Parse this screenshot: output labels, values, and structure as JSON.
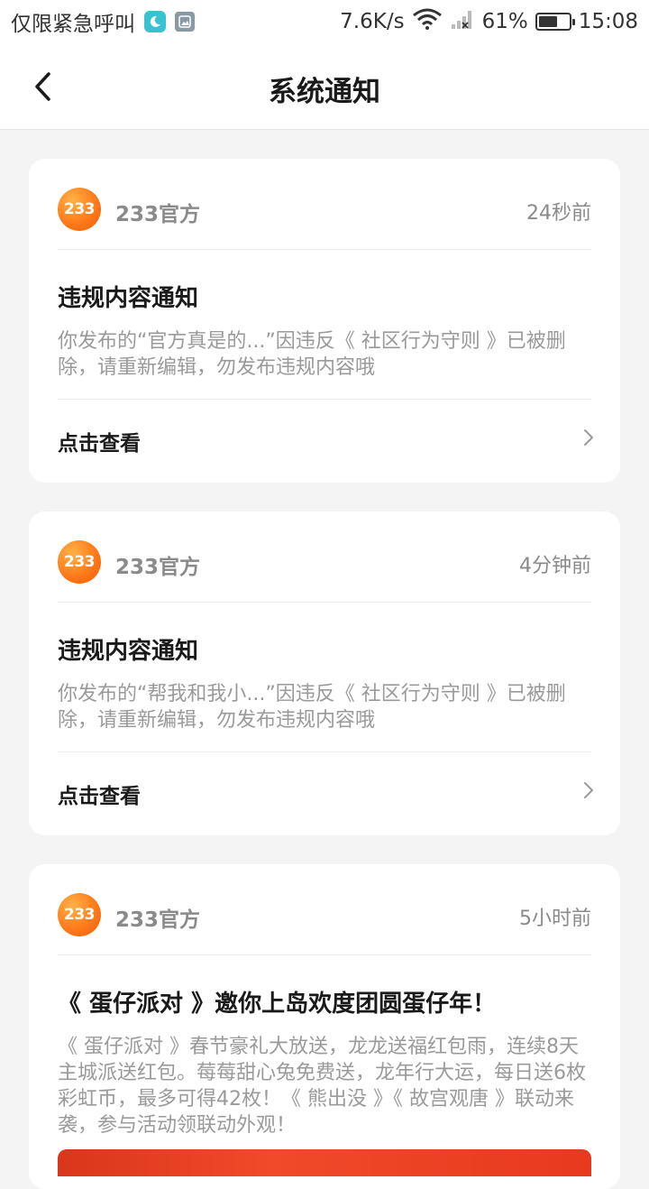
{
  "status_bar": {
    "carrier_text": "仅限紧急呼叫",
    "net_speed": "7.6K/s",
    "battery_percent": "61%",
    "battery_level": 0.61,
    "time": "15:08"
  },
  "nav": {
    "title": "系统通知"
  },
  "notifications": [
    {
      "author": "233官方",
      "avatar_text": "233",
      "time": "24秒前",
      "title": "违规内容通知",
      "body": "你发布的“官方真是的...”因违反《 社区行为守则 》已被删除，请重新编辑，勿发布违规内容哦",
      "link_label": "点击查看"
    },
    {
      "author": "233官方",
      "avatar_text": "233",
      "time": "4分钟前",
      "title": "违规内容通知",
      "body": "你发布的“帮我和我小...”因违反《 社区行为守则 》已被删除，请重新编辑，勿发布违规内容哦",
      "link_label": "点击查看"
    },
    {
      "author": "233官方",
      "avatar_text": "233",
      "time": "5小时前",
      "title": "《 蛋仔派对 》邀你上岛欢度团圆蛋仔年！",
      "body": "《 蛋仔派对 》春节豪礼大放送，龙龙送福红包雨，连续8天主城派送红包。莓莓甜心兔免费送，龙年行大运，每日送6枚彩虹币，最多可得42枚！《 熊出没 》《 故宫观唐 》联动来袭，参与活动领联动外观！"
    }
  ],
  "colors": {
    "accent": "#ff7a1a",
    "page_bg": "#f4f4f4",
    "card_bg": "#ffffff",
    "muted_text": "#8a8a8a"
  },
  "icons": {
    "back": "chevron-left-icon",
    "link": "chevron-right-icon",
    "moon": "moon-icon",
    "gallery": "image-icon",
    "wifi": "wifi-icon",
    "signal": "signal-icon",
    "battery": "battery-icon"
  }
}
